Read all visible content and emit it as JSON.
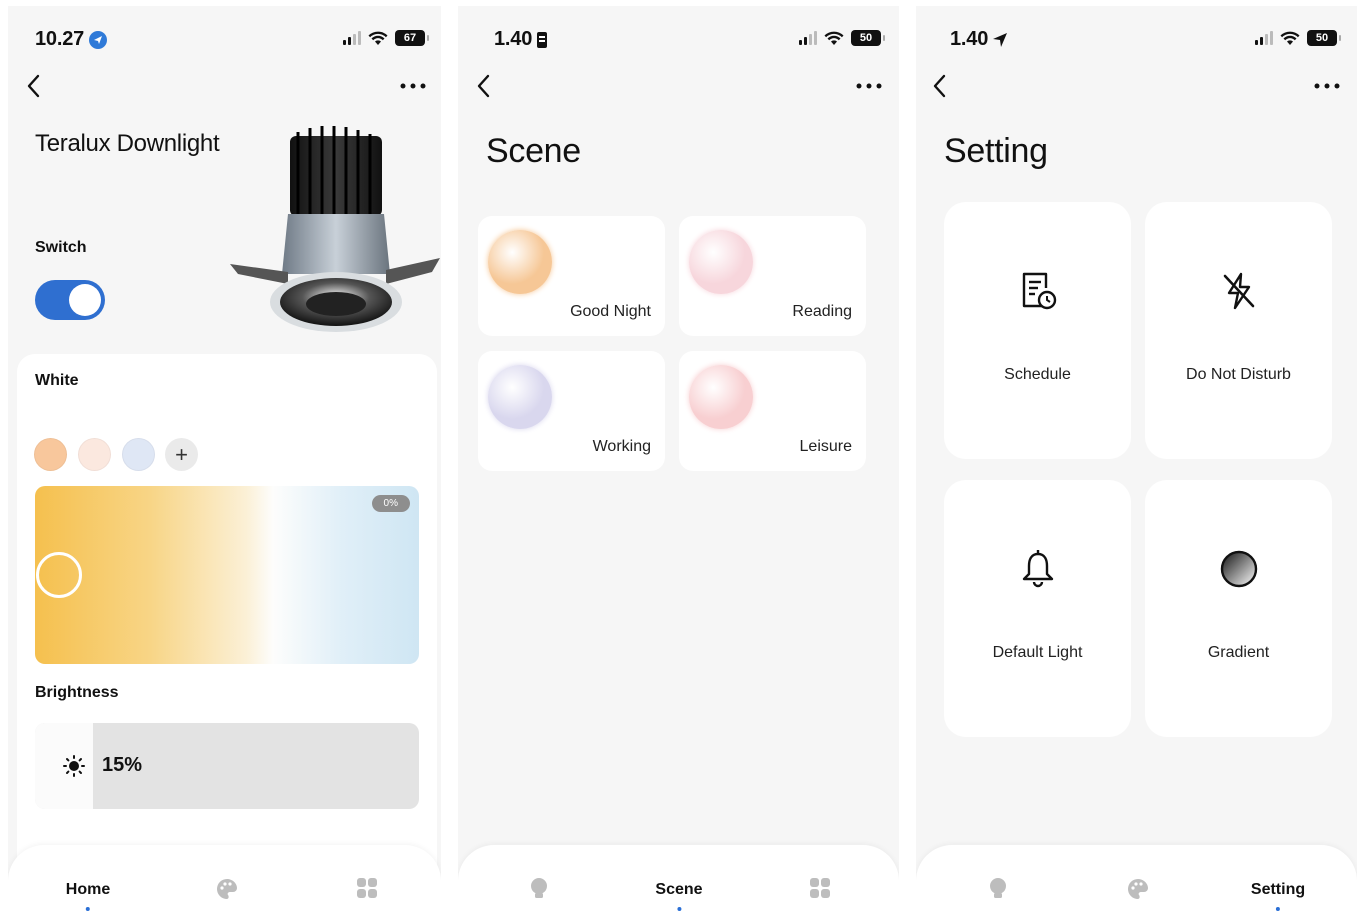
{
  "home": {
    "status": {
      "time": "10.27",
      "battery": "67"
    },
    "device_title": "Teralux Downlight",
    "switch_label": "Switch",
    "switch_on": true,
    "white_label": "White",
    "preset_colors": [
      "#f8c79c",
      "#fbe8df",
      "#dfe7f5"
    ],
    "add_symbol": "+",
    "cct_percent_label": "0%",
    "brightness_label": "Brightness",
    "brightness_value": "15%",
    "brightness_fraction": 0.15,
    "tabs": [
      "Home",
      "",
      ""
    ]
  },
  "scene": {
    "status": {
      "time": "1.40",
      "battery": "50"
    },
    "title": "Scene",
    "items": [
      {
        "label": "Good Night",
        "color": "#f6c796"
      },
      {
        "label": "Reading",
        "color": "#f7d6dc"
      },
      {
        "label": "Working",
        "color": "#d9d7ee"
      },
      {
        "label": "Leisure",
        "color": "#f8cfd1"
      }
    ],
    "tabs": [
      "",
      "Scene",
      ""
    ]
  },
  "setting": {
    "status": {
      "time": "1.40",
      "battery": "50"
    },
    "title": "Setting",
    "items": [
      {
        "label": "Schedule",
        "icon": "schedule-icon"
      },
      {
        "label": "Do Not Disturb",
        "icon": "no-disturb-icon"
      },
      {
        "label": "Default Light",
        "icon": "bell-icon"
      },
      {
        "label": "Gradient",
        "icon": "gradient-icon"
      }
    ],
    "tabs": [
      "",
      "",
      "Setting"
    ]
  },
  "colors": {
    "accent": "#2f6fd0",
    "tab_indicator": "#2a6fd6"
  }
}
